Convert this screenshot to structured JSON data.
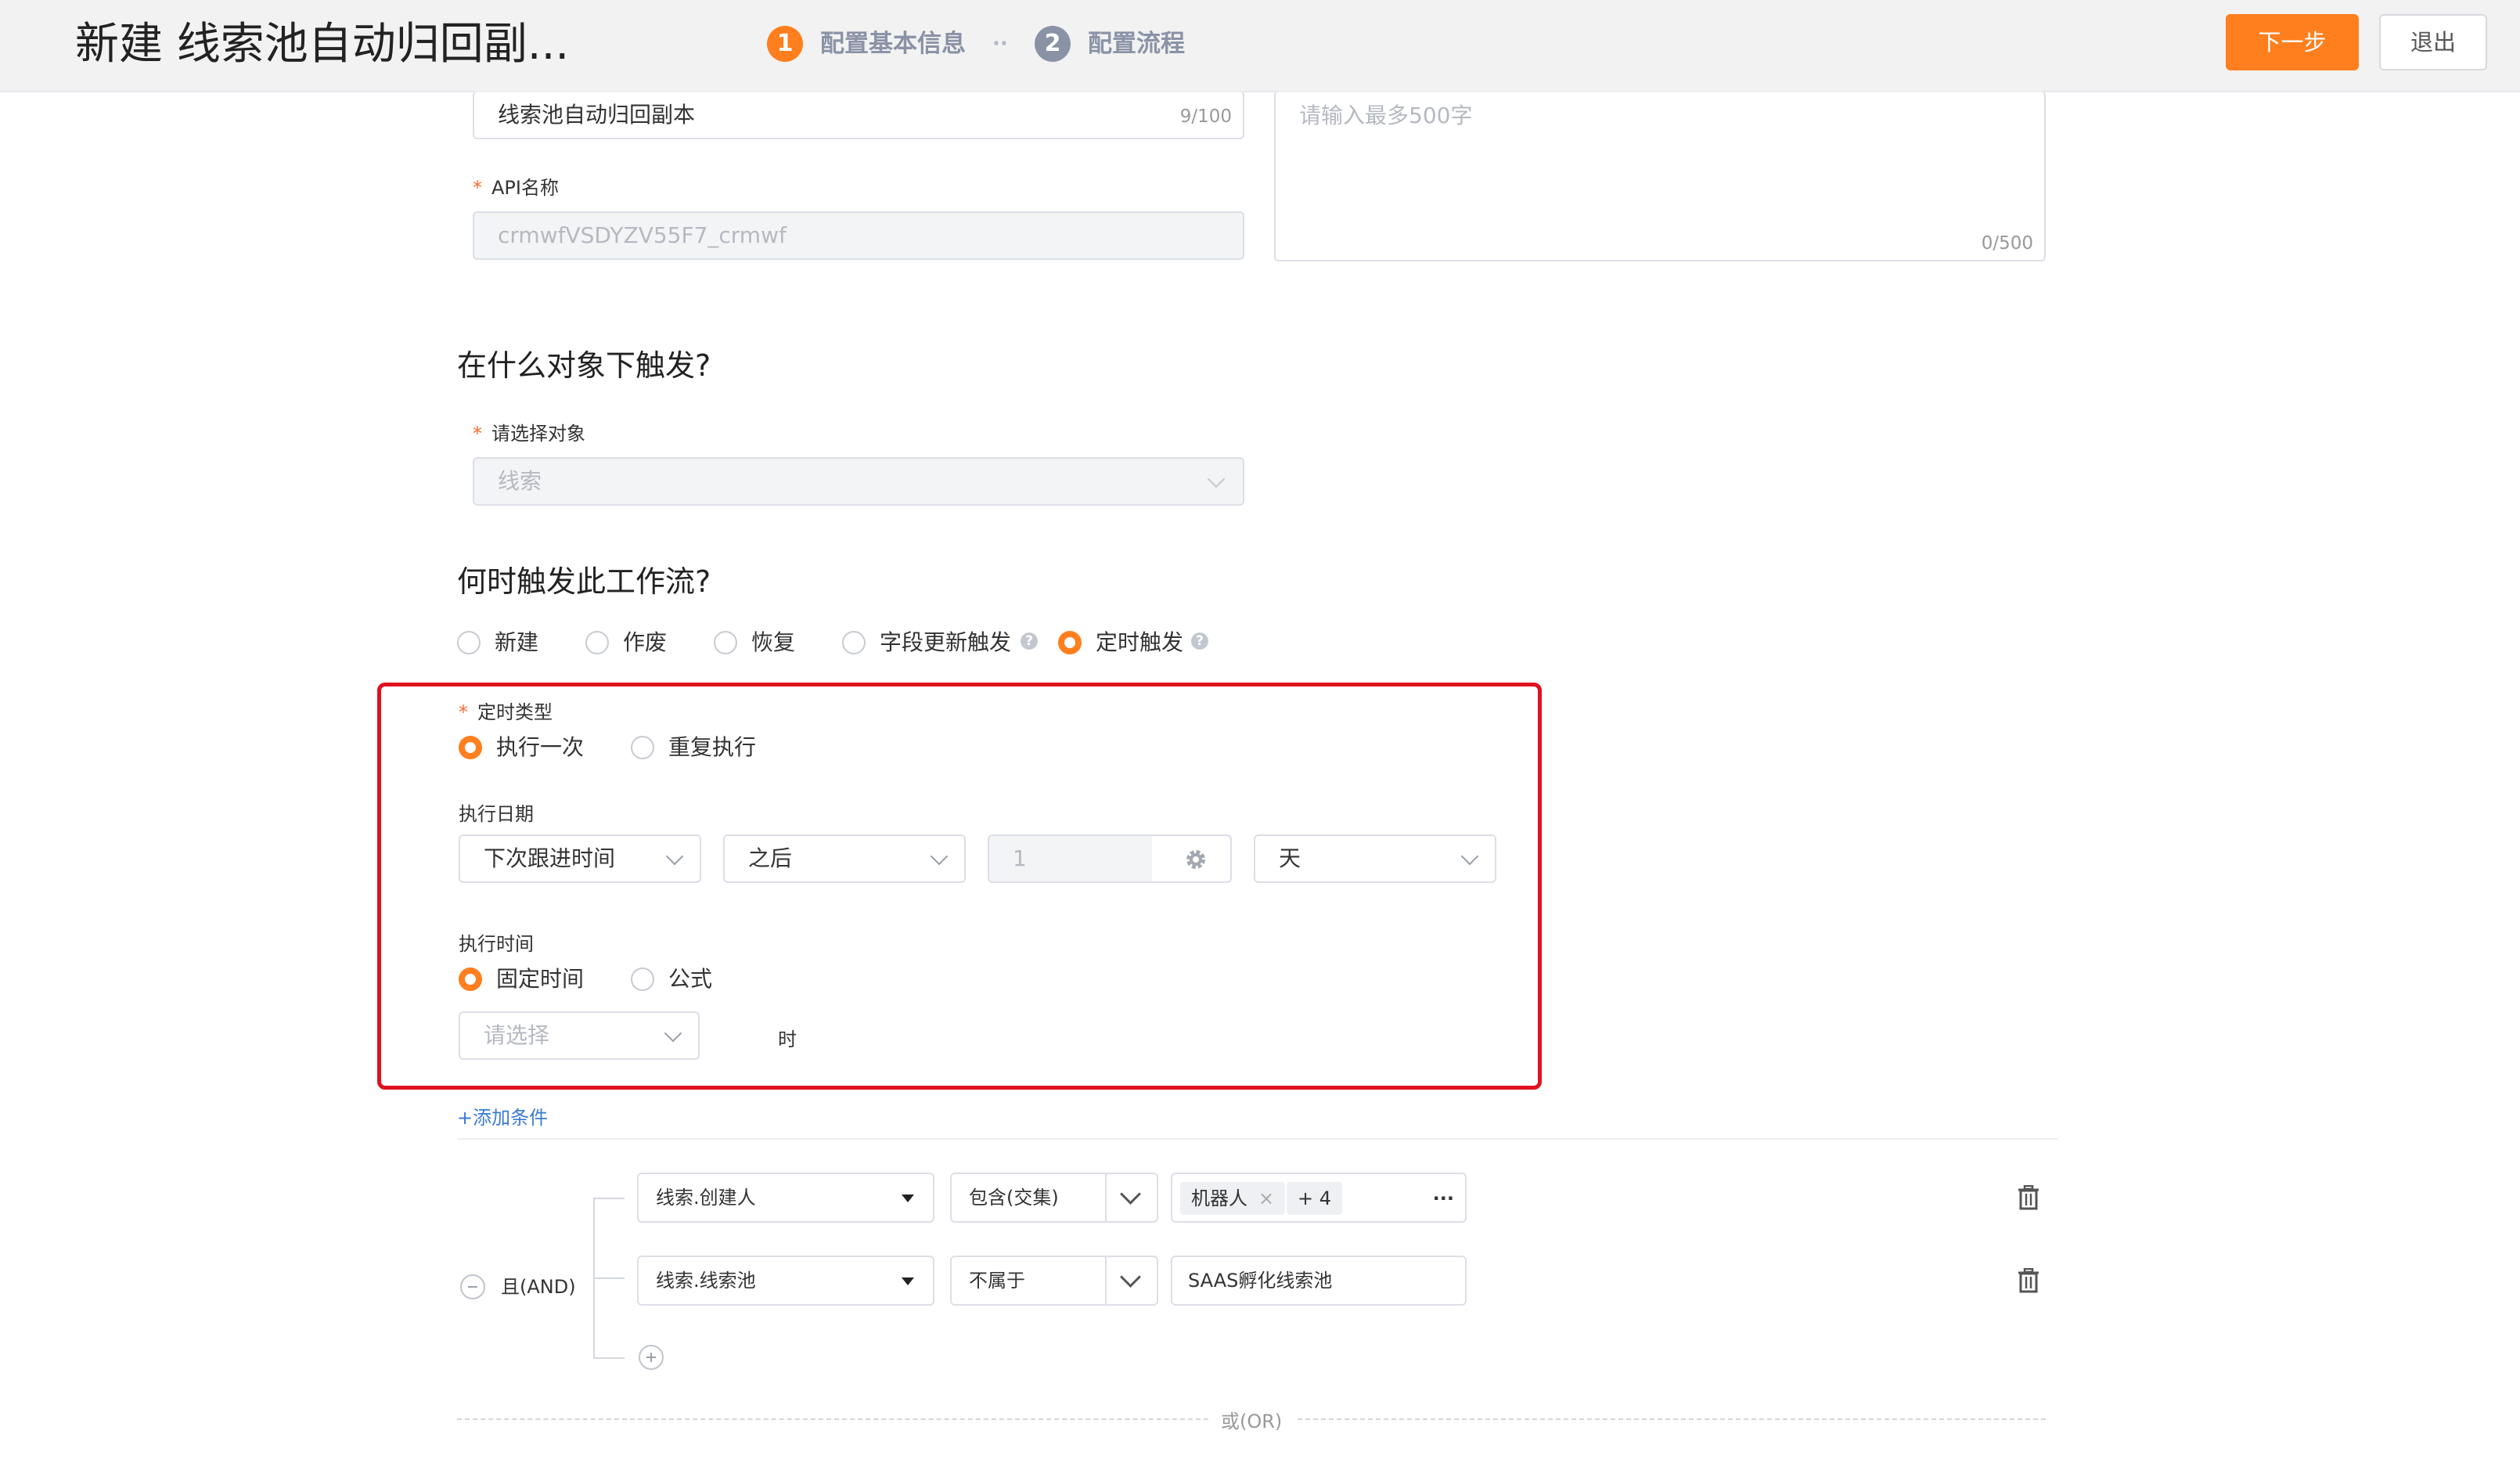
{
  "header": {
    "title": "新建 线索池自动归回副...",
    "steps": [
      {
        "num": "1",
        "label": "配置基本信息",
        "color": "#ff7f1e"
      },
      {
        "num": "2",
        "label": "配置流程",
        "color": "#8a93a6"
      }
    ],
    "step_separator": "··",
    "next_label": "下一步",
    "exit_label": "退出"
  },
  "basic": {
    "name_value": "线索池自动归回副本",
    "name_counter": "9/100",
    "api_label": "API名称",
    "api_value": "crmwfVSDYZV55F7_crmwf",
    "desc_placeholder": "请输入最多500字",
    "desc_counter": "0/500"
  },
  "object_section": {
    "title": "在什么对象下触发?",
    "select_label": "请选择对象",
    "select_value": "线索"
  },
  "trigger_section": {
    "title": "何时触发此工作流?",
    "options": [
      "新建",
      "作废",
      "恢复",
      "字段更新触发",
      "定时触发"
    ],
    "selected": "定时触发",
    "help_glyph": "?"
  },
  "timer": {
    "type_label": "定时类型",
    "type_options": [
      "执行一次",
      "重复执行"
    ],
    "type_selected": "执行一次",
    "date_label": "执行日期",
    "date_field": "下次跟进时间",
    "date_direction": "之后",
    "date_amount": "1",
    "date_unit": "天",
    "time_label": "执行时间",
    "time_options": [
      "固定时间",
      "公式"
    ],
    "time_selected": "固定时间",
    "hour_placeholder": "请选择",
    "hour_suffix": "时",
    "highlight_color": "#e0121f"
  },
  "conditions": {
    "add_label": "+添加条件",
    "logic_label": "且(AND)",
    "or_label": "或(OR)",
    "rows": [
      {
        "field": "线索.创建人",
        "operator": "包含(交集)",
        "tag": "机器人",
        "more": "+ 4",
        "ellipsis": "···"
      },
      {
        "field": "线索.线索池",
        "operator": "不属于",
        "value": "SAAS孵化线索池"
      }
    ]
  },
  "colors": {
    "accent": "#ff7f1e",
    "link": "#3a7bd5"
  }
}
